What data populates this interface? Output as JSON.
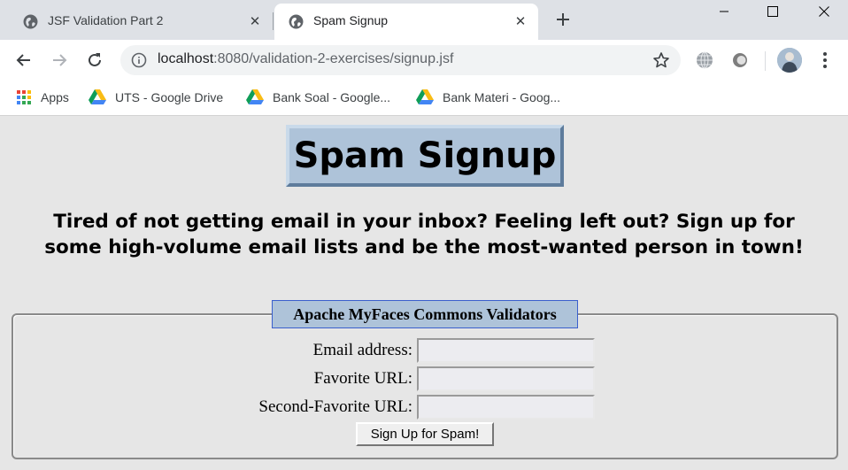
{
  "browser": {
    "tabs": [
      {
        "title": "JSF Validation Part 2",
        "active": false,
        "icon": "globe-icon"
      },
      {
        "title": "Spam Signup",
        "active": true,
        "icon": "globe-icon"
      }
    ],
    "new_tab_label": "+",
    "window_controls": {
      "minimize": "—",
      "maximize": "☐",
      "close": "✕"
    },
    "toolbar": {
      "url_host": "localhost",
      "url_rest": ":8080/validation-2-exercises/signup.jsf"
    },
    "bookmarks": [
      {
        "label": "Apps",
        "icon": "apps-grid-icon"
      },
      {
        "label": "UTS - Google Drive",
        "icon": "google-drive-icon"
      },
      {
        "label": "Bank Soal - Google...",
        "icon": "google-drive-icon"
      },
      {
        "label": "Bank Materi - Goog...",
        "icon": "google-drive-icon"
      }
    ],
    "colors": {
      "tabstrip": "#dee1e6",
      "omnibox": "#f1f3f4",
      "drive_yellow": "#f9bc15",
      "drive_green": "#0f9d58",
      "drive_blue": "#4285f4"
    }
  },
  "page": {
    "title": "Spam Signup",
    "intro_line1": "Tired of not getting email in your inbox? Feeling left out? Sign up for",
    "intro_line2": "some high-volume email lists and be the most-wanted person in town!",
    "legend": "Apache MyFaces Commons Validators",
    "form": {
      "fields": [
        {
          "label": "Email address:",
          "value": ""
        },
        {
          "label": "Favorite URL:",
          "value": ""
        },
        {
          "label": "Second-Favorite URL:",
          "value": ""
        }
      ],
      "submit_label": "Sign Up for Spam!"
    },
    "colors": {
      "background": "#e6e6e6",
      "title_box": "#aec3d9",
      "legend_border": "#3a5fcd"
    }
  }
}
